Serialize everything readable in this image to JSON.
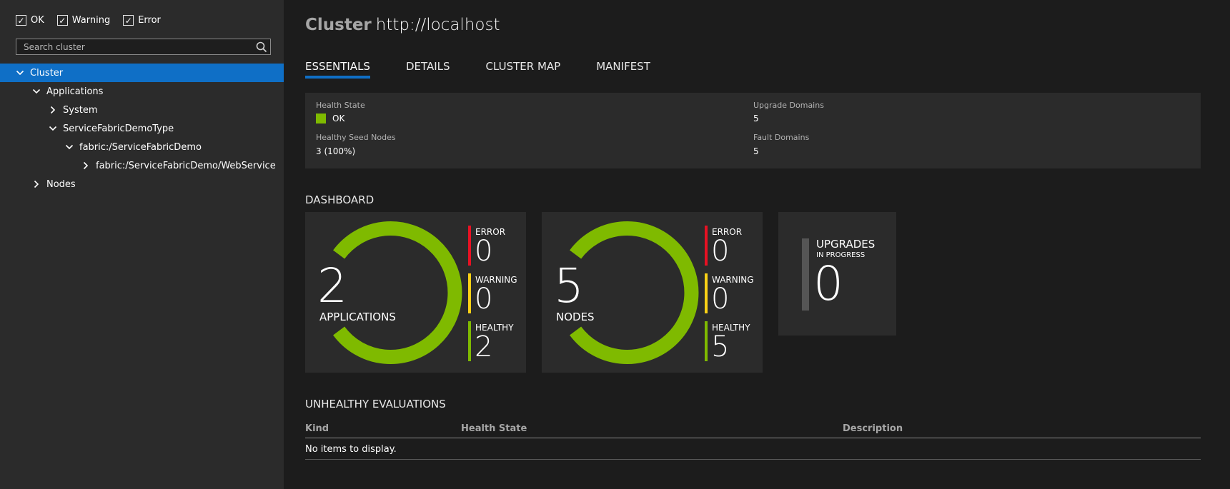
{
  "sidebar": {
    "filters": [
      {
        "label": "OK",
        "checked": true
      },
      {
        "label": "Warning",
        "checked": true
      },
      {
        "label": "Error",
        "checked": true
      }
    ],
    "search": {
      "placeholder": "Search cluster",
      "value": ""
    },
    "tree": [
      {
        "label": "Cluster",
        "expanded": true,
        "selected": true
      },
      {
        "label": "Applications",
        "expanded": true
      },
      {
        "label": "System",
        "expanded": false
      },
      {
        "label": "ServiceFabricDemoType",
        "expanded": true
      },
      {
        "label": "fabric:/ServiceFabricDemo",
        "expanded": true
      },
      {
        "label": "fabric:/ServiceFabricDemo/WebService",
        "expanded": false
      },
      {
        "label": "Nodes",
        "expanded": false
      }
    ]
  },
  "header": {
    "kind": "Cluster",
    "name": "http://localhost"
  },
  "tabs": [
    {
      "label": "ESSENTIALS",
      "active": true
    },
    {
      "label": "DETAILS",
      "active": false
    },
    {
      "label": "CLUSTER MAP",
      "active": false
    },
    {
      "label": "MANIFEST",
      "active": false
    }
  ],
  "essentials": {
    "health_state_label": "Health State",
    "health_state_value": "OK",
    "seed_nodes_label": "Healthy Seed Nodes",
    "seed_nodes_value": "3 (100%)",
    "upgrade_domains_label": "Upgrade Domains",
    "upgrade_domains_value": "5",
    "fault_domains_label": "Fault Domains",
    "fault_domains_value": "5"
  },
  "dashboard": {
    "title": "DASHBOARD",
    "applications": {
      "count": "2",
      "label": "APPLICATIONS",
      "error_label": "ERROR",
      "error": "0",
      "warning_label": "WARNING",
      "warning": "0",
      "healthy_label": "HEALTHY",
      "healthy": "2"
    },
    "nodes": {
      "count": "5",
      "label": "NODES",
      "error_label": "ERROR",
      "error": "0",
      "warning_label": "WARNING",
      "warning": "0",
      "healthy_label": "HEALTHY",
      "healthy": "5"
    },
    "upgrades": {
      "title": "UPGRADES",
      "subtitle": "IN PROGRESS",
      "count": "0"
    }
  },
  "unhealthy": {
    "title": "UNHEALTHY EVALUATIONS",
    "columns": [
      "Kind",
      "Health State",
      "Description"
    ],
    "empty_text": "No items to display."
  },
  "colors": {
    "accent": "#0f6fc6",
    "healthy": "#7fba00",
    "error": "#e81123",
    "warning": "#fcd116",
    "sidebar_bg": "#2b2b2b",
    "main_bg": "#1c1c1c"
  }
}
